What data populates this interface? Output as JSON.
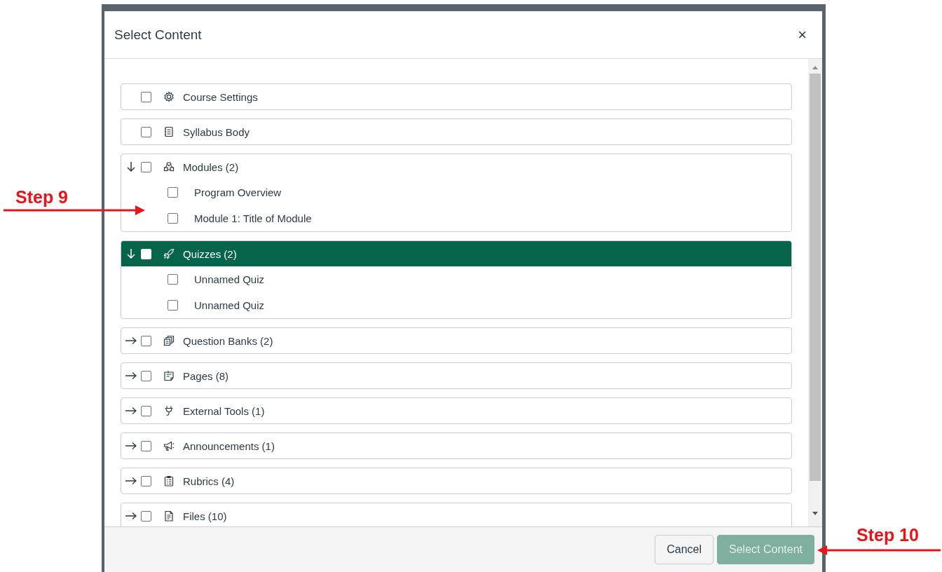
{
  "dialog": {
    "title": "Select Content",
    "close": "×",
    "items": [
      {
        "kind": "single",
        "label": "Course Settings",
        "checked": false,
        "selected": false
      },
      {
        "kind": "single",
        "label": "Syllabus Body",
        "checked": false,
        "selected": false
      },
      {
        "kind": "group",
        "label": "Modules (2)",
        "checked": false,
        "selected": false,
        "expanded": true,
        "children": [
          {
            "label": "Program Overview",
            "checked": false
          },
          {
            "label": "Module 1: Title of Module",
            "checked": false
          }
        ]
      },
      {
        "kind": "group",
        "label": "Quizzes (2)",
        "checked": false,
        "selected": true,
        "expanded": true,
        "children": [
          {
            "label": "Unnamed Quiz",
            "checked": false
          },
          {
            "label": "Unnamed Quiz",
            "checked": false
          }
        ]
      },
      {
        "kind": "group",
        "label": "Question Banks (2)",
        "checked": false,
        "selected": false,
        "expanded": false
      },
      {
        "kind": "group",
        "label": "Pages (8)",
        "checked": false,
        "selected": false,
        "expanded": false
      },
      {
        "kind": "group",
        "label": "External Tools (1)",
        "checked": false,
        "selected": false,
        "expanded": false
      },
      {
        "kind": "group",
        "label": "Announcements (1)",
        "checked": false,
        "selected": false,
        "expanded": false
      },
      {
        "kind": "group",
        "label": "Rubrics (4)",
        "checked": false,
        "selected": false,
        "expanded": false
      },
      {
        "kind": "group",
        "label": "Files (10)",
        "checked": false,
        "selected": false,
        "expanded": false
      }
    ],
    "buttons": [
      {
        "label": "Cancel",
        "kind": "secondary",
        "disabled": false
      },
      {
        "label": "Select Content",
        "kind": "primary",
        "disabled": true
      }
    ]
  },
  "annotations": [
    {
      "label": "Step 9",
      "kind": "right"
    },
    {
      "label": "Step 10",
      "kind": "left"
    }
  ]
}
